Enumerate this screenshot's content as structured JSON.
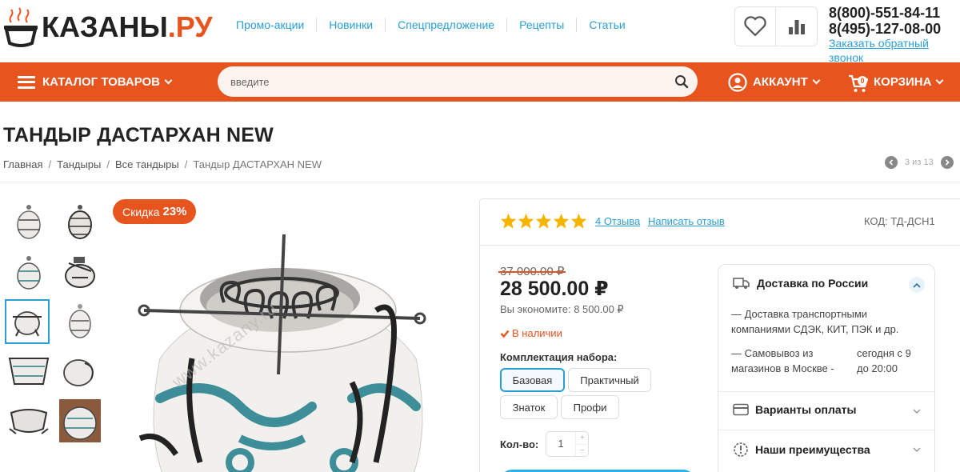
{
  "logo": {
    "text_main": "КАЗАНЫ",
    "text_suffix": ".РУ"
  },
  "topnav": [
    "Промо-акции",
    "Новинки",
    "Спецпредложение",
    "Рецепты",
    "Статьи"
  ],
  "contacts": {
    "phone1": "8(800)-551-84-11",
    "phone2": "8(495)-127-08-00",
    "callback": "Заказать обратный звонок"
  },
  "icons": {
    "wishlist": "heart-icon",
    "compare": "bar-chart-icon",
    "search": "search-icon",
    "account": "user-icon",
    "cart": "cart-icon"
  },
  "bar": {
    "catalog": "КАТАЛОГ ТОВАРОВ",
    "search_placeholder": "введите",
    "account": "АККАУНТ",
    "cart": "КОРЗИНА",
    "cart_count": "0"
  },
  "colors": {
    "accent": "#e8541e",
    "link": "#2a9fd6",
    "star": "#f5b400"
  },
  "page": {
    "title": "ТАНДЫР ДАСТАРХАН NEW",
    "breadcrumbs": [
      "Главная",
      "Тандыры",
      "Все тандыры",
      "Тандыр ДАСТАРХАН NEW"
    ],
    "pager": "3 из 13"
  },
  "gallery": {
    "badge_label": "Скидка",
    "badge_value": "23%",
    "watermark": "www.kazany.ru",
    "thumb_count": 10,
    "active_thumb": 5
  },
  "product": {
    "rating": 5,
    "reviews": "4 Отзыва",
    "write_review": "Написать отзыв",
    "code": "КОД: ТД-ДСН1",
    "old_price": "37 000.00 ₽",
    "price": "28 500.00 ₽",
    "savings": "Вы экономите: 8 500.00 ₽",
    "stock": "В наличии",
    "kit_label": "Комплектация набора:",
    "kits": [
      "Базовая",
      "Практичный",
      "Знаток",
      "Профи"
    ],
    "selected_kit": "Базовая",
    "qty_label": "Кол-во:",
    "qty": "1",
    "qty_plus": "+",
    "qty_minus": "−"
  },
  "delivery": {
    "title": "Доставка по России",
    "line1": "— Доставка транспортными компаниями СДЭК, КИТ, ПЭК и др.",
    "pickup_left": "— Самовывоз из магазинов в Москве -",
    "pickup_right": "сегодня с 9 до 20:00",
    "payment": "Варианты оплаты",
    "advantages": "Наши преимущества"
  }
}
